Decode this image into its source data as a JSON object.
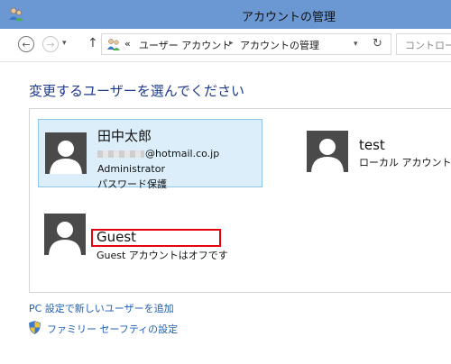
{
  "window": {
    "title": "アカウントの管理"
  },
  "nav": {
    "back_glyph": "←",
    "forward_glyph": "→",
    "up_glyph": "↑",
    "dropdown_glyph": "▾"
  },
  "address": {
    "overflow": "«",
    "segments": [
      "ユーザー アカウント",
      "アカウントの管理"
    ],
    "separator": "▸",
    "dropdown_glyph": "▾",
    "refresh_glyph": "↻"
  },
  "search": {
    "placeholder": "コントロール"
  },
  "main": {
    "heading": "変更するユーザーを選んでください",
    "accounts": [
      {
        "name": "田中太郎",
        "email_visible": "@hotmail.co.jp",
        "role": "Administrator",
        "status": "パスワード保護",
        "selected": true
      },
      {
        "name": "test",
        "role": "ローカル アカウント",
        "selected": false
      },
      {
        "name": "Guest",
        "status": "Guest アカウントはオフです",
        "highlighted": true
      }
    ]
  },
  "links": {
    "add_user": "PC 設定で新しいユーザーを追加",
    "family_safety": "ファミリー セーフティの設定"
  },
  "colors": {
    "titlebar": "#6b97d2",
    "heading": "#1e3a8a",
    "link": "#1e5fb4",
    "selected_tile": "#dbeefa",
    "highlight": "#e60012"
  }
}
